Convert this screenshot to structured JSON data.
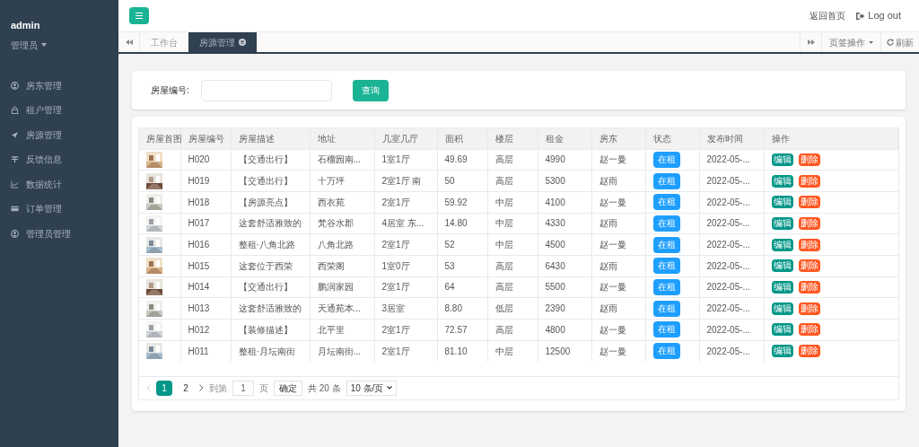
{
  "user": {
    "name": "admin",
    "role": "管理员"
  },
  "sidebar": {
    "items": [
      {
        "label": "房东管理"
      },
      {
        "label": "租户管理"
      },
      {
        "label": "房源管理"
      },
      {
        "label": "反馈信息"
      },
      {
        "label": "数据统计"
      },
      {
        "label": "订单管理"
      },
      {
        "label": "管理员管理"
      }
    ]
  },
  "header": {
    "home_link": "返回首页",
    "logout": "Log out"
  },
  "tabs": [
    {
      "label": "工作台",
      "selected": false,
      "closable": false
    },
    {
      "label": "房源管理",
      "selected": true,
      "closable": true
    }
  ],
  "tab_tools": {
    "page_ops": "页签操作",
    "refresh": "刷新"
  },
  "search": {
    "label": "房屋编号:",
    "button": "查询"
  },
  "table": {
    "columns": [
      "房屋首图",
      "房屋编号",
      "房屋描述",
      "地址",
      "几室几厅",
      "面积",
      "楼层",
      "租金",
      "房东",
      "状态",
      "发布时间",
      "操作"
    ],
    "rows": [
      {
        "code": "H020",
        "description": "【交通出行】",
        "address": "石榴园南...",
        "layout": "1室1厅",
        "area": "49.69",
        "floor": "高层",
        "rent": "4990",
        "landlord": "赵一曼",
        "status": "在租",
        "published": "2022-05-...",
        "actions": [
          "编辑",
          "删除"
        ]
      },
      {
        "code": "H019",
        "description": "【交通出行】",
        "address": "十万坪",
        "layout": "2室1厅 南",
        "area": "50",
        "floor": "高层",
        "rent": "5300",
        "landlord": "赵雨",
        "status": "在租",
        "published": "2022-05-...",
        "actions": [
          "编辑",
          "删除"
        ]
      },
      {
        "code": "H018",
        "description": "【房源亮点】",
        "address": "西衣苑",
        "layout": "2室1厅",
        "area": "59.92",
        "floor": "中层",
        "rent": "4100",
        "landlord": "赵一曼",
        "status": "在租",
        "published": "2022-05-...",
        "actions": [
          "编辑",
          "删除"
        ]
      },
      {
        "code": "H017",
        "description": "这套舒适雅致的",
        "address": "梵谷水郡",
        "layout": "4居室 东...",
        "area": "14.80",
        "floor": "中层",
        "rent": "4330",
        "landlord": "赵雨",
        "status": "在租",
        "published": "2022-05-...",
        "actions": [
          "编辑",
          "删除"
        ]
      },
      {
        "code": "H016",
        "description": "整租·八角北路",
        "address": "八角北路",
        "layout": "2室1厅",
        "area": "52",
        "floor": "中层",
        "rent": "4500",
        "landlord": "赵一曼",
        "status": "在租",
        "published": "2022-05-...",
        "actions": [
          "编辑",
          "删除"
        ]
      },
      {
        "code": "H015",
        "description": "这套位于西荣",
        "address": "西荣阁",
        "layout": "1室0厅",
        "area": "53",
        "floor": "高层",
        "rent": "6430",
        "landlord": "赵雨",
        "status": "在租",
        "published": "2022-05-...",
        "actions": [
          "编辑",
          "删除"
        ]
      },
      {
        "code": "H014",
        "description": "【交通出行】",
        "address": "鹏润家园",
        "layout": "2室1厅",
        "area": "64",
        "floor": "高层",
        "rent": "5500",
        "landlord": "赵一曼",
        "status": "在租",
        "published": "2022-05-...",
        "actions": [
          "编辑",
          "删除"
        ]
      },
      {
        "code": "H013",
        "description": "这套舒适雅致的",
        "address": "天通苑本...",
        "layout": "3居室",
        "area": "8.80",
        "floor": "低层",
        "rent": "2390",
        "landlord": "赵雨",
        "status": "在租",
        "published": "2022-05-...",
        "actions": [
          "编辑",
          "删除"
        ]
      },
      {
        "code": "H012",
        "description": "【装修描述】",
        "address": "北平里",
        "layout": "2室1厅",
        "area": "72.57",
        "floor": "高层",
        "rent": "4800",
        "landlord": "赵一曼",
        "status": "在租",
        "published": "2022-05-...",
        "actions": [
          "编辑",
          "删除"
        ]
      },
      {
        "code": "H011",
        "description": "整租·月坛南街",
        "address": "月坛南街...",
        "layout": "2室1厅",
        "area": "81.10",
        "floor": "中层",
        "rent": "12500",
        "landlord": "赵一曼",
        "status": "在租",
        "published": "2022-05-...",
        "actions": [
          "编辑",
          "删除"
        ]
      }
    ]
  },
  "pagination": {
    "pages": [
      {
        "label": "1",
        "selected": true
      },
      {
        "label": "2",
        "selected": false
      }
    ],
    "goto": "到第",
    "page_value": "1",
    "page_unit": "页",
    "confirm": "确定",
    "total": "共 20 条",
    "page_size": "10 条/页"
  }
}
